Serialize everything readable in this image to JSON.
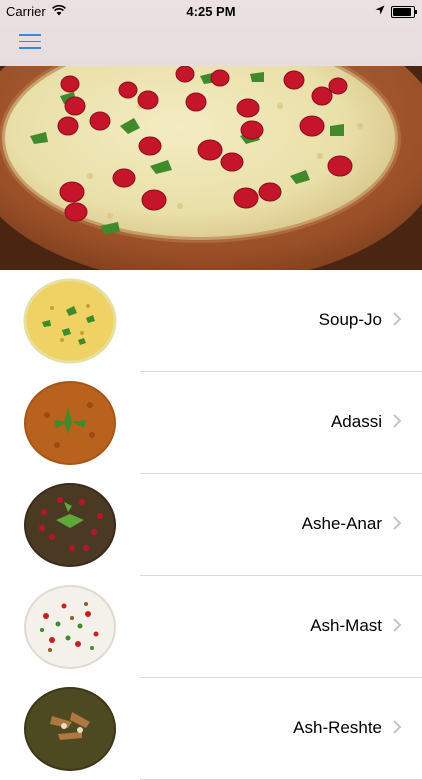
{
  "status_bar": {
    "carrier": "Carrier",
    "time": "4:25 PM",
    "icons": [
      "wifi-icon",
      "location-arrow-icon",
      "battery-icon"
    ]
  },
  "nav": {
    "menu_icon": "hamburger-menu-icon",
    "accent_color": "#3c88d8"
  },
  "hero": {
    "image": "soup bowl with pomegranate seeds and herbs"
  },
  "items": [
    {
      "label": "Soup-Jo"
    },
    {
      "label": "Adassi"
    },
    {
      "label": "Ashe-Anar"
    },
    {
      "label": "Ash-Mast"
    },
    {
      "label": "Ash-Reshte"
    }
  ]
}
